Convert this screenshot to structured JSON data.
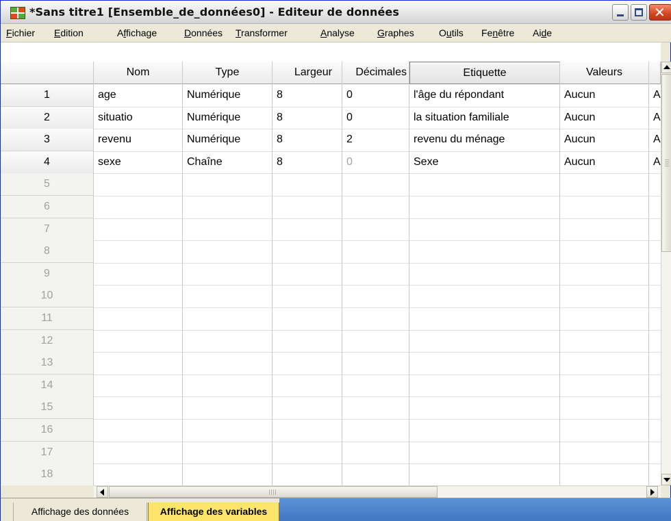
{
  "window": {
    "title": "*Sans titre1 [Ensemble_de_données0] - Editeur de données"
  },
  "menu": [
    {
      "pre": "",
      "u": "F",
      "post": "ichier"
    },
    {
      "pre": "",
      "u": "E",
      "post": "dition"
    },
    {
      "pre": "A",
      "u": "f",
      "post": "fichage"
    },
    {
      "pre": "",
      "u": "D",
      "post": "onnées"
    },
    {
      "pre": "",
      "u": "T",
      "post": "ransformer"
    },
    {
      "pre": "",
      "u": "A",
      "post": "nalyse"
    },
    {
      "pre": "",
      "u": "G",
      "post": "raphes"
    },
    {
      "pre": "O",
      "u": "u",
      "post": "tils"
    },
    {
      "pre": "Fe",
      "u": "n",
      "post": "être"
    },
    {
      "pre": "Ai",
      "u": "d",
      "post": "e"
    }
  ],
  "grid": {
    "columns": [
      "Nom",
      "Type",
      "Largeur",
      "Décimales",
      "Etiquette",
      "Valeurs",
      ""
    ],
    "rows": [
      {
        "num": "1",
        "cells": [
          "age",
          "Numérique",
          "8",
          "0",
          "l'âge du répondant",
          "Aucun",
          "A"
        ]
      },
      {
        "num": "2",
        "cells": [
          "situatio",
          "Numérique",
          "8",
          "0",
          "la situation familiale",
          "Aucun",
          "A"
        ]
      },
      {
        "num": "3",
        "cells": [
          "revenu",
          "Numérique",
          "8",
          "2",
          "revenu du ménage",
          "Aucun",
          "A"
        ]
      },
      {
        "num": "4",
        "cells": [
          "sexe",
          "Chaîne",
          "8",
          "0",
          "Sexe",
          "Aucun",
          "A"
        ]
      }
    ],
    "empty_rows": [
      "5",
      "6",
      "7",
      "8",
      "9",
      "10",
      "11",
      "12",
      "13",
      "14",
      "15",
      "16",
      "17",
      "18"
    ]
  },
  "tabs": {
    "data_view": "Affichage des données",
    "variable_view": "Affichage des variables",
    "active": "variable_view"
  },
  "colors": {
    "active_tab": "#fde46a",
    "title_close": "#d24520",
    "tabbar_accent": "#4a82cc"
  }
}
